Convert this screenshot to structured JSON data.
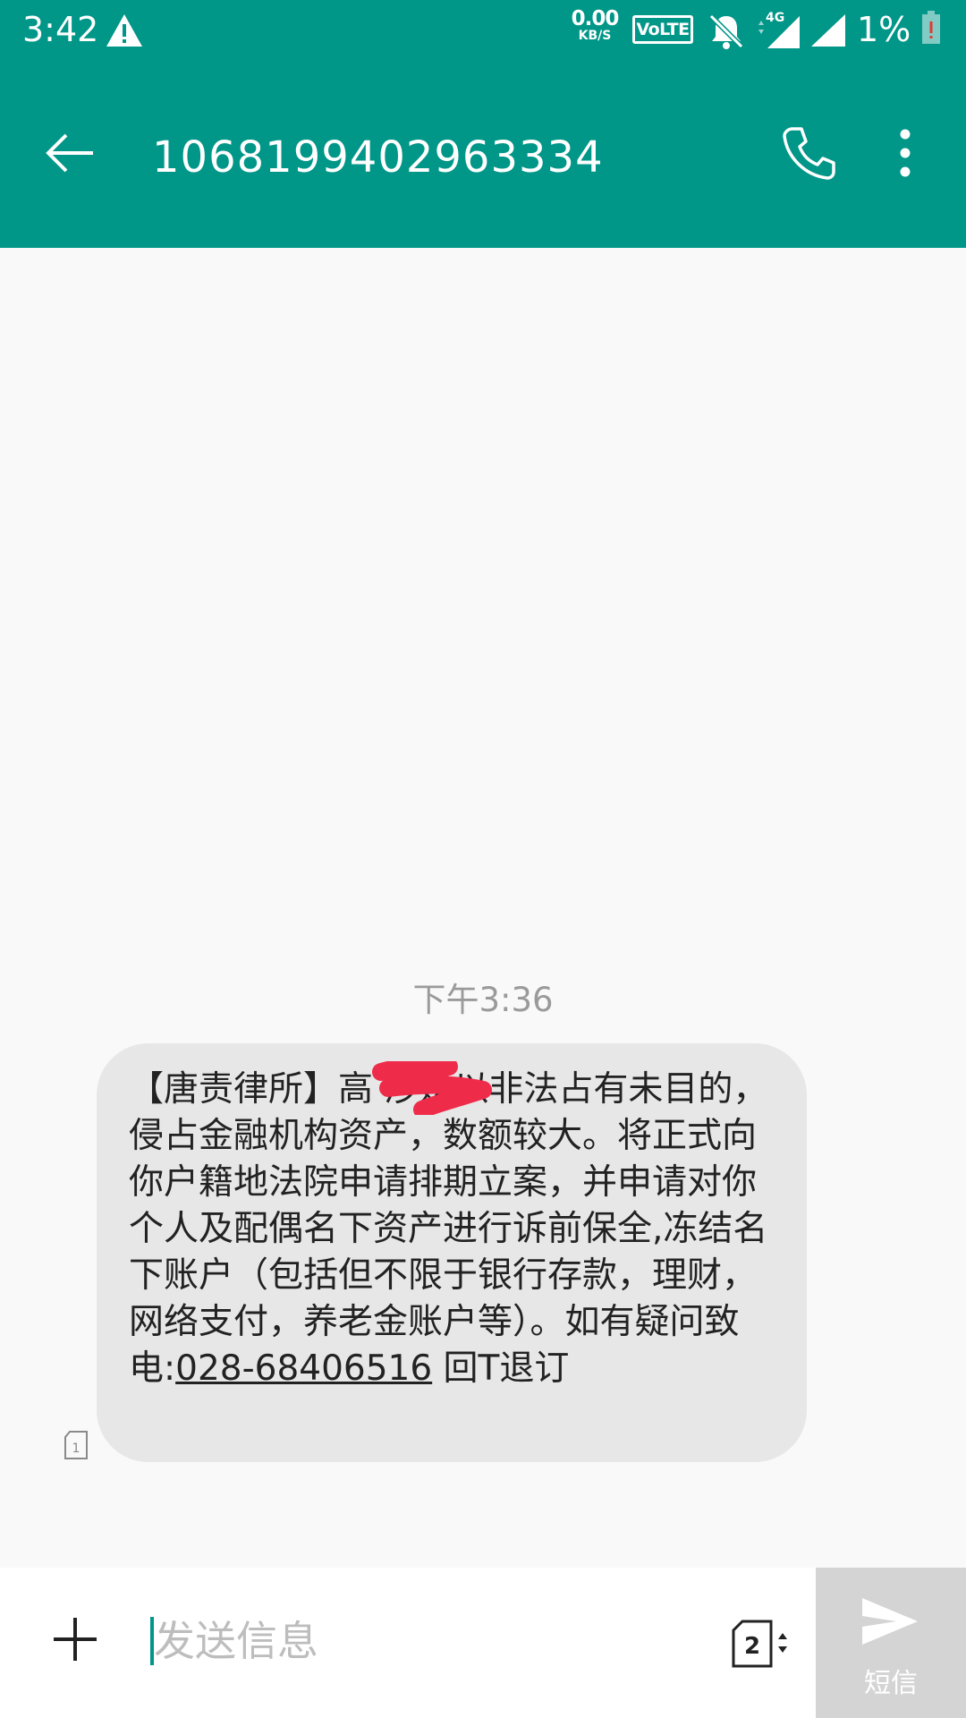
{
  "status_bar": {
    "time": "3:42",
    "net_speed_value": "0.00",
    "net_speed_unit": "KB/S",
    "volte": "VoLTE",
    "network": "4G",
    "battery_text": "1%",
    "icons": [
      "warning-icon",
      "volte-icon",
      "bell-off-icon",
      "signal-icon",
      "battery-low-icon"
    ]
  },
  "app_bar": {
    "title": "1068199402963334",
    "icons": [
      "back-arrow-icon",
      "phone-icon",
      "more-vert-icon"
    ],
    "background": "#009688"
  },
  "conversation": {
    "timestamp": "下午3:36",
    "message": {
      "text_before": "【唐责律所】高      涉嫌以非法占有未目的，侵占金融机构资产，数额较大。将正式向你户籍地法院申请排期立案，并申请对你个人及配偶名下资产进行诉前保全,冻结名下账户（包括但不限于银行存款，理财，网络支付，养老金账户等）。如有疑问致电:",
      "link": "028-68406516",
      "text_after": " 回T退订",
      "sim_slot": "1"
    }
  },
  "composer": {
    "placeholder": "发送信息",
    "sim_selected": "2",
    "send_label": "短信",
    "icons": [
      "add-icon",
      "sim-switch-icon",
      "send-icon"
    ]
  },
  "colors": {
    "accent": "#009688",
    "bubble": "#e7e7e7",
    "redaction": "#ef2b4a"
  }
}
